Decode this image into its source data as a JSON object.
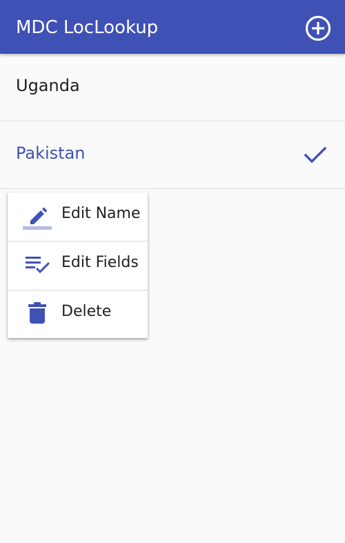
{
  "app_bar": {
    "title": "MDC LocLookup",
    "add_icon": "add-circle-outline-icon",
    "color": "#3f51b5"
  },
  "locations": [
    {
      "name": "Uganda",
      "selected": false
    },
    {
      "name": "Pakistan",
      "selected": true,
      "status_icon": "check-icon"
    }
  ],
  "context_menu": {
    "items": [
      {
        "label": "Edit Name",
        "icon": "edit-pencil-icon"
      },
      {
        "label": "Edit Fields",
        "icon": "playlist-check-icon"
      },
      {
        "label": "Delete",
        "icon": "trash-icon"
      }
    ]
  },
  "colors": {
    "primary": "#3f51b5",
    "background": "#fafafa",
    "text": "#212121"
  }
}
